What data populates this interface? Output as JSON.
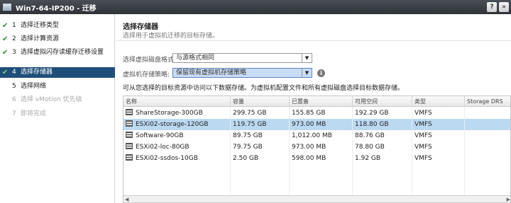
{
  "window": {
    "title": "Win7-64-IP200 - 迁移",
    "help_label": "?",
    "expand_label": "»"
  },
  "steps": [
    {
      "num": "1",
      "label": "选择迁移类型",
      "done": true
    },
    {
      "num": "2",
      "label": "选择计算资源",
      "done": true
    },
    {
      "num": "3",
      "label": "选择虚拟闪存读缓存迁移设置",
      "done": true
    },
    {
      "num": "4",
      "label": "选择存储器",
      "done": true,
      "active": true
    },
    {
      "num": "5",
      "label": "选择网络",
      "done": false
    },
    {
      "num": "6",
      "label": "选择 vMotion 优先级",
      "done": false,
      "disabled": true
    },
    {
      "num": "7",
      "label": "即将完成",
      "done": false,
      "disabled": true
    }
  ],
  "content": {
    "heading": "选择存储器",
    "subheading": "选择用于虚拟机迁移的目标存储。",
    "disk_format_label": "选择虚拟磁盘格式:",
    "disk_format_value": "与源格式相同",
    "storage_policy_label": "虚拟机存储策略:",
    "storage_policy_value": "保留现有虚拟机存储策略",
    "note": "可从您选择的目标资源中访问以下数据存储。为虚拟机配置文件和所有虚拟磁盘选择目标数据存储。"
  },
  "table": {
    "columns": [
      "名称",
      "容量",
      "已置备",
      "可用空间",
      "类型",
      "Storage DRS"
    ],
    "rows": [
      {
        "name": "ShareStorage-300GB",
        "capacity": "299.75 GB",
        "provisioned": "155.85 GB",
        "free": "192.29 GB",
        "type": "VMFS",
        "sdrs": ""
      },
      {
        "name": "ESXi02-storage-120GB",
        "capacity": "119.75 GB",
        "provisioned": "973.00 MB",
        "free": "118.80 GB",
        "type": "VMFS",
        "sdrs": "",
        "selected": true
      },
      {
        "name": "Software-90GB",
        "capacity": "89.75 GB",
        "provisioned": "1,012.00 MB",
        "free": "88.76 GB",
        "type": "VMFS",
        "sdrs": ""
      },
      {
        "name": "ESXi02-loc-80GB",
        "capacity": "79.75 GB",
        "provisioned": "973.00 MB",
        "free": "78.80 GB",
        "type": "VMFS",
        "sdrs": ""
      },
      {
        "name": "ESXi02-ssdos-10GB",
        "capacity": "2.50 GB",
        "provisioned": "598.00 MB",
        "free": "1.92 GB",
        "type": "VMFS",
        "sdrs": ""
      }
    ]
  },
  "colors": {
    "active_step_bg": "#1f4e79",
    "selected_row_bg": "#bcd9f2",
    "check_green": "#2e8b2e"
  },
  "icons": [
    "window-icon",
    "check-icon",
    "datastore-icon",
    "info-icon",
    "dropdown-arrow-icon"
  ]
}
